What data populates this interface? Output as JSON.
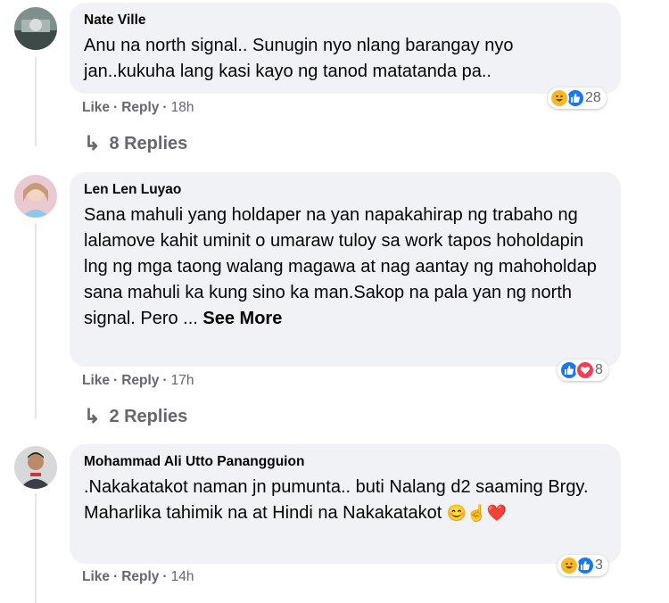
{
  "comments": [
    {
      "author": "Nate Ville",
      "text": "Anu na north signal.. Sunugin nyo nlang barangay nyo jan..kukuha lang kasi kayo ng tanod matatanda pa..",
      "like_label": "Like",
      "reply_label": "Reply",
      "time": "18h",
      "reaction_count": "28",
      "reactions": [
        "haha-icon",
        "like-icon"
      ],
      "replies_label": "8 Replies"
    },
    {
      "author": "Len Len Luyao",
      "text": "Sana mahuli yang holdaper na yan napakahirap ng trabaho ng lalamove kahit uminit o umaraw tuloy sa work tapos hoholdapin lng ng mga taong walang magawa at nag aantay ng mahoholdap sana mahuli ka kung sino ka man.Sakop na pala yan ng north signal. Pero ...",
      "see_more": "See More",
      "like_label": "Like",
      "reply_label": "Reply",
      "time": "17h",
      "reaction_count": "8",
      "reactions": [
        "like-icon",
        "love-icon"
      ],
      "replies_label": "2 Replies"
    },
    {
      "author": "Mohammad Ali Utto Panangguion",
      "text": ".Nakakatakot naman jn pumunta.. buti Nalang d2 saaming Brgy. Maharlika tahimik na at Hindi na Nakakatakot",
      "emojis": "😊☝️❤️",
      "like_label": "Like",
      "reply_label": "Reply",
      "time": "14h",
      "reaction_count": "3",
      "reactions": [
        "haha-icon",
        "like-icon"
      ]
    }
  ],
  "colors": {
    "bubble": "#f0f2f5",
    "meta": "#65676b",
    "like_reaction": "#1877f2",
    "haha_reaction": "#f7b928",
    "love_reaction": "#f33e58"
  }
}
